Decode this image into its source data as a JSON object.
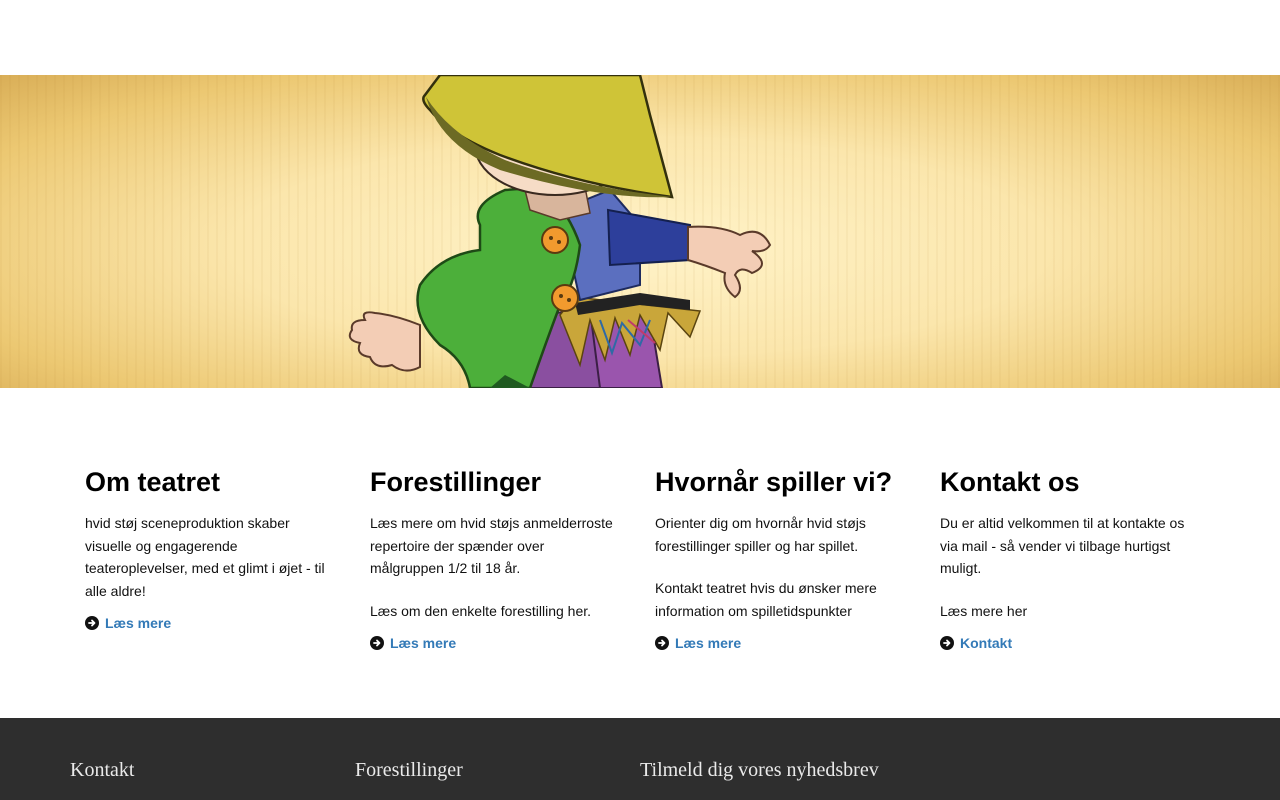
{
  "sections": [
    {
      "title": "Om teatret",
      "paragraphs": [
        "hvid støj sceneproduktion skaber visuelle og engagerende teateroplevelser, med et glimt i øjet - til alle aldre!"
      ],
      "link_label": "Læs mere"
    },
    {
      "title": "Forestillinger",
      "paragraphs": [
        "Læs mere om hvid støjs anmelderroste repertoire der spænder over målgruppen 1/2 til 18 år.",
        "Læs om den enkelte forestilling her."
      ],
      "link_label": "Læs mere"
    },
    {
      "title": "Hvornår spiller vi?",
      "paragraphs": [
        "Orienter dig om hvornår hvid støjs forestillinger spiller og har spillet.",
        "Kontakt teatret hvis du ønsker mere information om spilletidspunkter"
      ],
      "link_label": "Læs mere"
    },
    {
      "title": "Kontakt os",
      "paragraphs": [
        "Du er altid velkommen til at kontakte os via mail - så vender vi tilbage hurtigst muligt.",
        "Læs mere her"
      ],
      "link_label": "Kontakt"
    }
  ],
  "footer": {
    "col1_title": "Kontakt",
    "col2_title": "Forestillinger",
    "col3_title": "Tilmeld dig vores nyhedsbrev"
  },
  "colors": {
    "link": "#337ab7",
    "footer_bg": "#2e2e2e",
    "hero_center": "#fff3c9",
    "hero_edge": "#d9ae57"
  },
  "icons": {
    "link_arrow": "circle-arrow-right-icon",
    "hero": "scarecrow-illustration"
  }
}
